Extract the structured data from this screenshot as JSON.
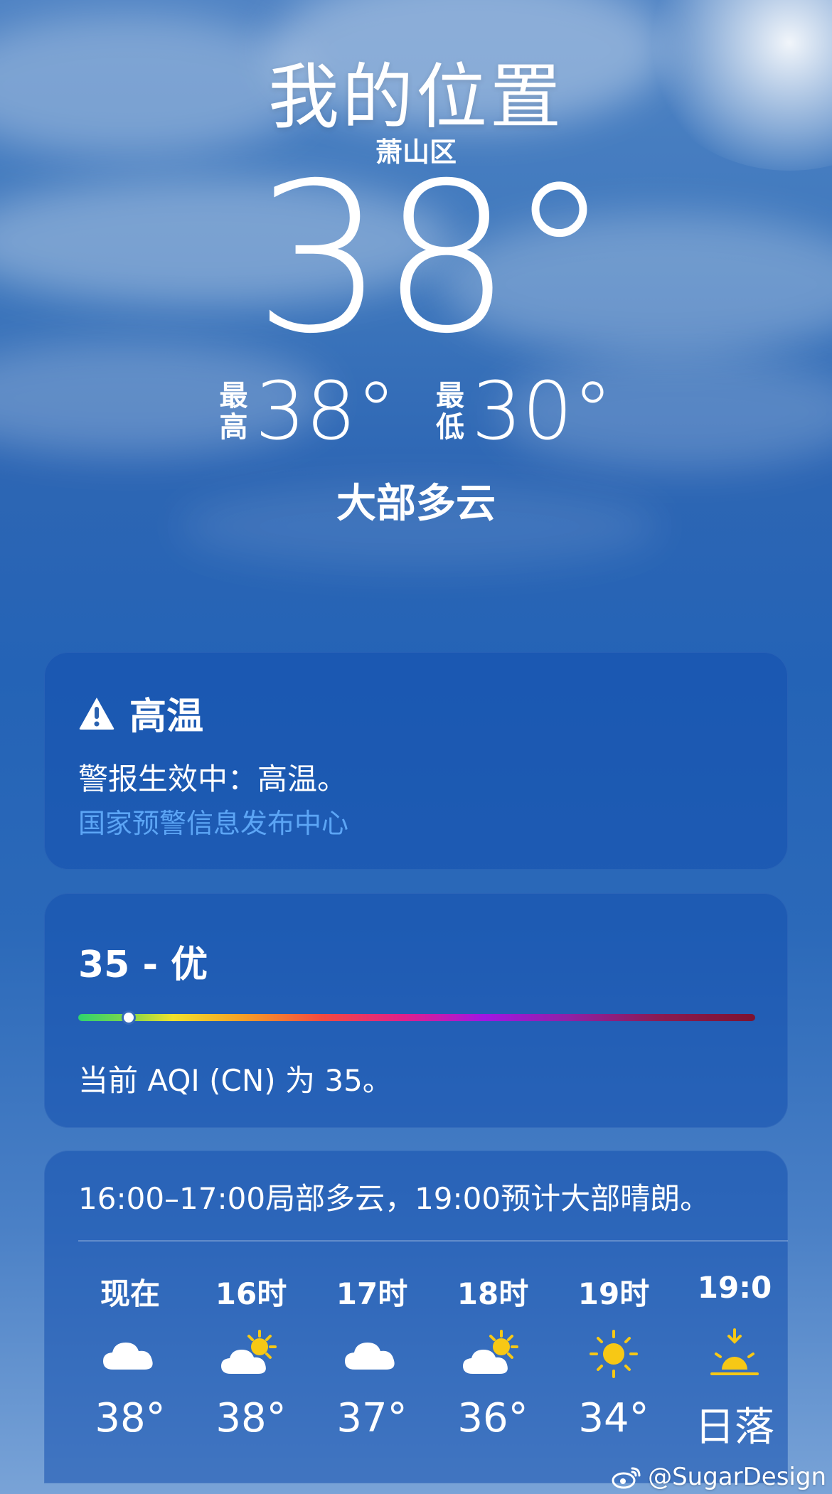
{
  "header": {
    "location": "我的位置",
    "district": "萧山区",
    "current_temp": "38°",
    "high_label_1": "最",
    "high_label_2": "高",
    "high_value": "38°",
    "low_label_1": "最",
    "low_label_2": "低",
    "low_value": "30°",
    "condition": "大部多云"
  },
  "alert": {
    "icon": "warning-triangle-icon",
    "title": "高温",
    "text": "警报生效中：高温。",
    "source": "国家预警信息发布中心",
    "source_color": "#5ca5f5"
  },
  "aqi": {
    "value_text": "35 - 优",
    "value": 35,
    "indicator_fraction": 0.075,
    "description": "当前 AQI (CN) 为 35。"
  },
  "forecast": {
    "summary": "16:00–17:00局部多云，19:00预计大部晴朗。",
    "hours": [
      {
        "label": "现在",
        "icon": "cloud-icon",
        "temp": "38°"
      },
      {
        "label": "16时",
        "icon": "partly-sunny-icon",
        "temp": "38°"
      },
      {
        "label": "17时",
        "icon": "cloud-icon",
        "temp": "37°"
      },
      {
        "label": "18时",
        "icon": "partly-sunny-icon",
        "temp": "36°"
      },
      {
        "label": "19时",
        "icon": "sun-icon",
        "temp": "34°"
      },
      {
        "label": "19:0",
        "icon": "sunset-icon",
        "temp": "日落"
      }
    ]
  },
  "watermark": {
    "text": "@SugarDesign",
    "icon": "weibo-icon"
  }
}
